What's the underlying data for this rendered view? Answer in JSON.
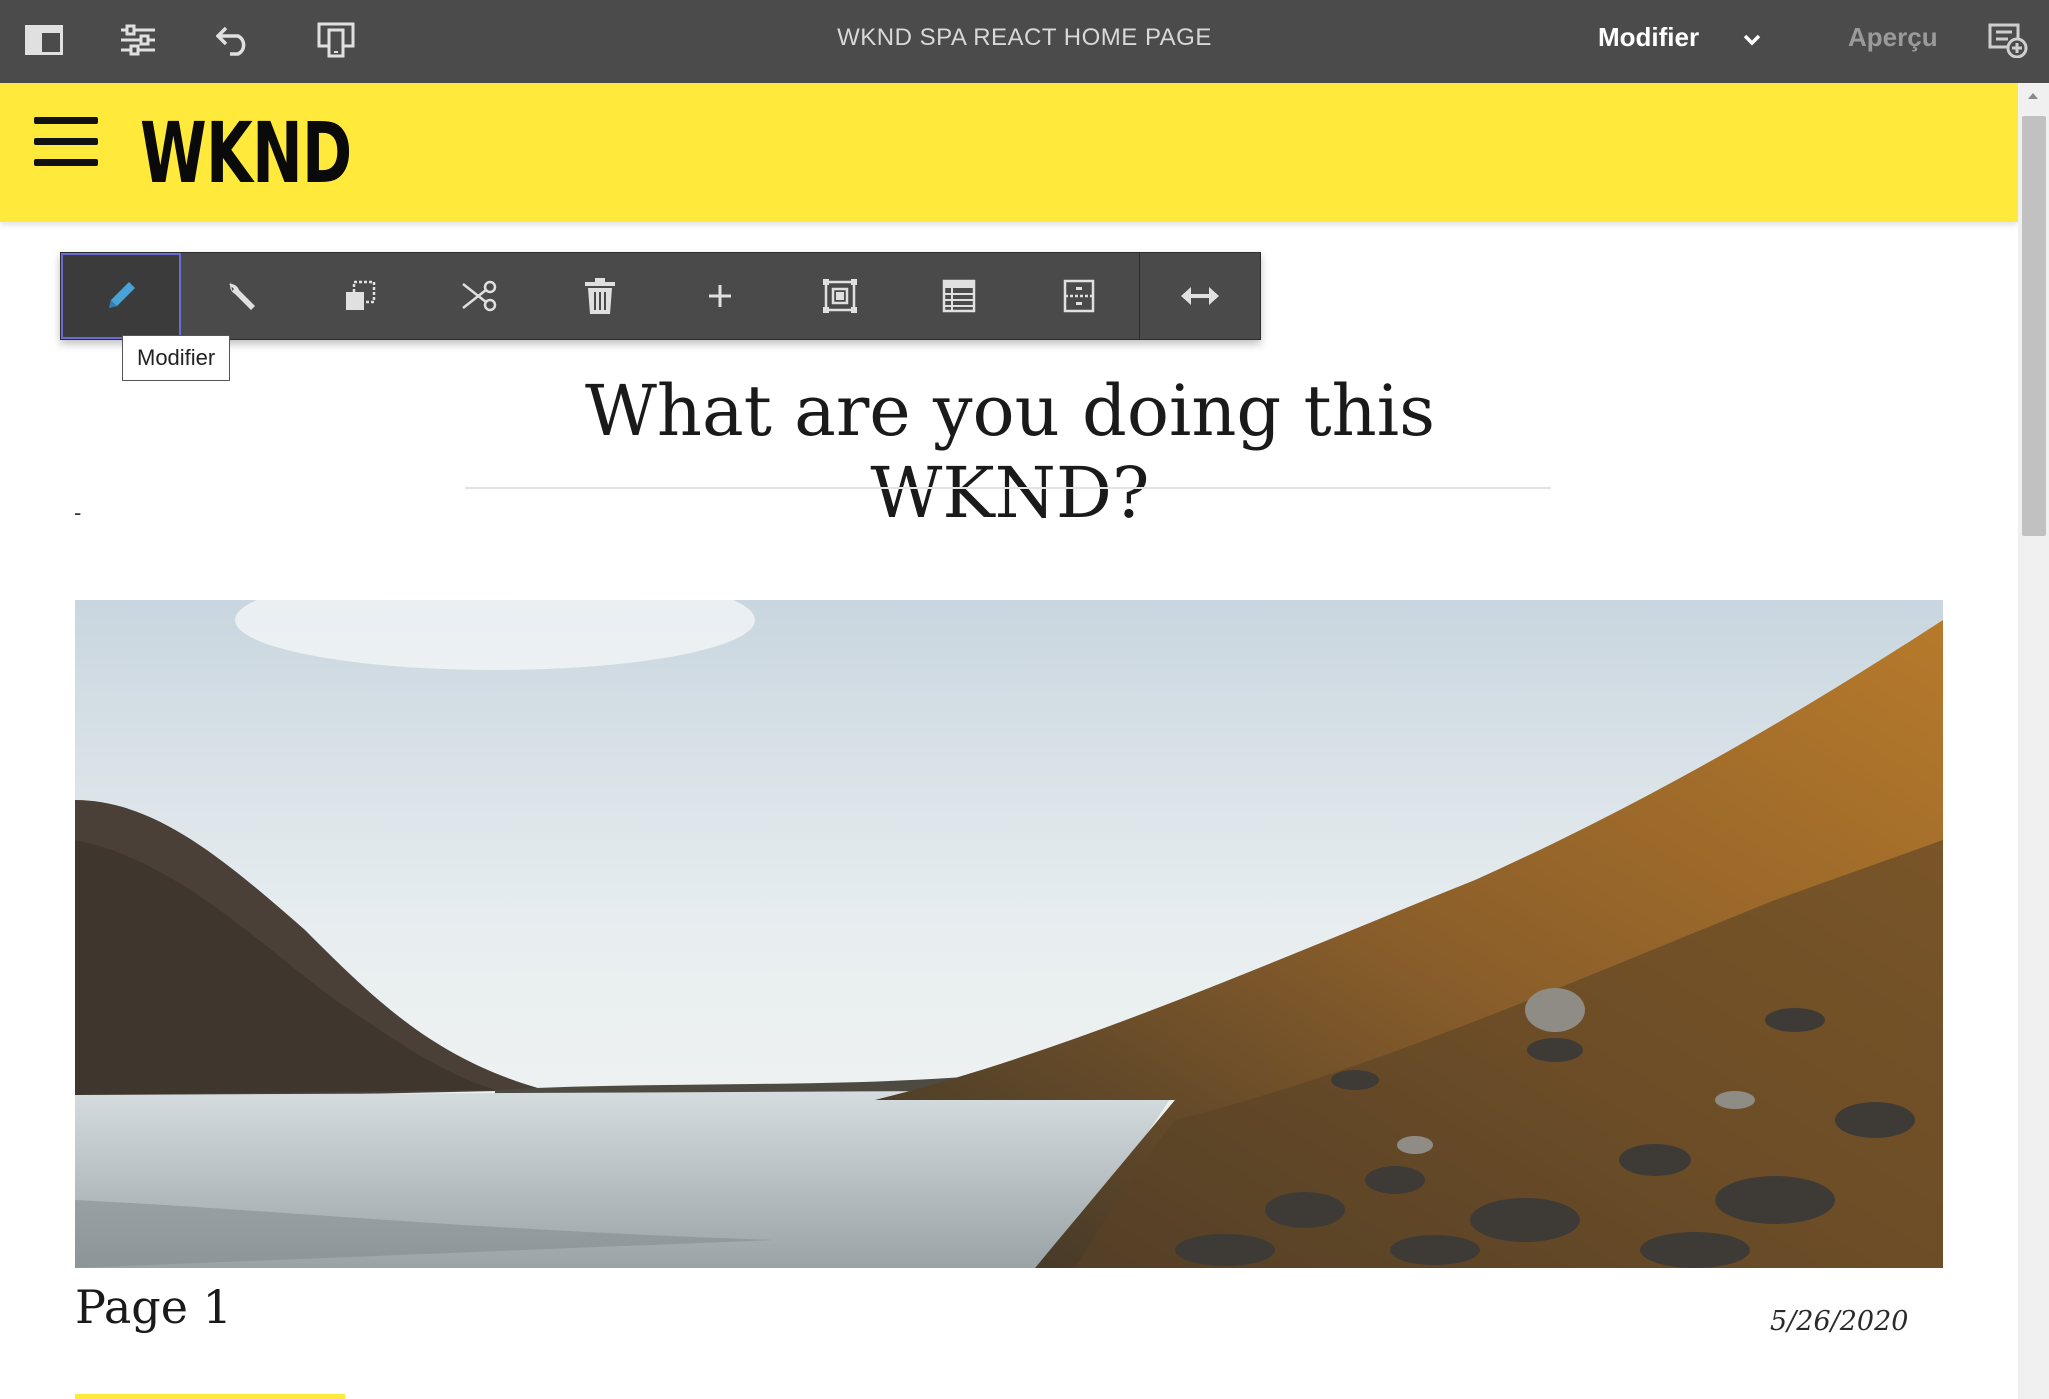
{
  "editor_bar": {
    "page_title": "WKND SPA REACT HOME PAGE",
    "mode_label": "Modifier",
    "preview_label": "Aperçu",
    "icons": [
      "side-panel-icon",
      "page-properties-icon",
      "undo-icon",
      "emulator-icon",
      "annotations-icon"
    ]
  },
  "site_header": {
    "logo_text": "WKND",
    "background_color": "#ffea3b"
  },
  "component_toolbar": {
    "buttons": [
      {
        "name": "edit-button",
        "icon": "pencil-icon"
      },
      {
        "name": "configure-button",
        "icon": "wrench-icon"
      },
      {
        "name": "copy-button",
        "icon": "copy-icon"
      },
      {
        "name": "cut-button",
        "icon": "scissors-icon"
      },
      {
        "name": "delete-button",
        "icon": "trash-icon"
      },
      {
        "name": "insert-button",
        "icon": "plus-icon"
      },
      {
        "name": "parent-button",
        "icon": "select-parent-icon"
      },
      {
        "name": "layout-button",
        "icon": "table-icon"
      },
      {
        "name": "group-button",
        "icon": "group-icon"
      },
      {
        "name": "resize-button",
        "icon": "arrows-horizontal-icon"
      }
    ],
    "tooltip": "Modifier",
    "active_color": "#4aa3d6"
  },
  "content": {
    "title": "What are you doing this WKND?",
    "separator_text": "-",
    "card": {
      "title": "Page 1",
      "date": "5/26/2020"
    }
  }
}
